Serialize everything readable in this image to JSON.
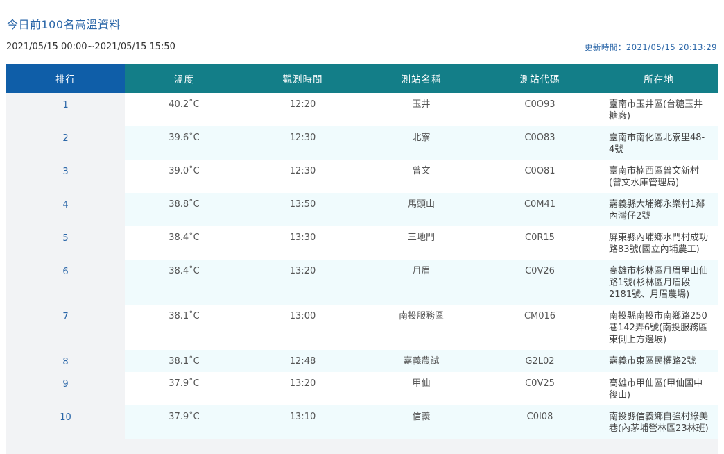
{
  "header": {
    "title": "今日前100名高溫資料",
    "range": "2021/05/15 00:00~2021/05/15 15:50",
    "update": "更新時間：2021/05/15 20:13:29"
  },
  "table": {
    "columns": [
      "排行",
      "溫度",
      "觀測時間",
      "測站名稱",
      "測站代碼",
      "所在地"
    ],
    "rows": [
      {
        "rank": "1",
        "temp": "40.2˚C",
        "time": "12:20",
        "name": "玉井",
        "code": "C0O93",
        "loc": "臺南市玉井區(台糖玉井糖廠)"
      },
      {
        "rank": "2",
        "temp": "39.6˚C",
        "time": "12:30",
        "name": "北寮",
        "code": "C0O83",
        "loc": "臺南市南化區北寮里48-4號"
      },
      {
        "rank": "3",
        "temp": "39.0˚C",
        "time": "12:30",
        "name": "曾文",
        "code": "C0O81",
        "loc": "臺南市楠西區曾文新村(曾文水庫管理局)"
      },
      {
        "rank": "4",
        "temp": "38.8˚C",
        "time": "13:50",
        "name": "馬頭山",
        "code": "C0M41",
        "loc": "嘉義縣大埔鄉永樂村1鄰內灣仔2號"
      },
      {
        "rank": "5",
        "temp": "38.4˚C",
        "time": "13:30",
        "name": "三地門",
        "code": "C0R15",
        "loc": "屏東縣內埔鄉水門村成功路83號(國立內埔農工)"
      },
      {
        "rank": "6",
        "temp": "38.4˚C",
        "time": "13:20",
        "name": "月眉",
        "code": "C0V26",
        "loc": "高雄市杉林區月眉里山仙路1號(杉林區月眉段2181號、月眉農場)"
      },
      {
        "rank": "7",
        "temp": "38.1˚C",
        "time": "13:00",
        "name": "南投服務區",
        "code": "CM016",
        "loc": "南投縣南投市南鄉路250巷142弄6號(南投服務區東側上方邊坡)"
      },
      {
        "rank": "8",
        "temp": "38.1˚C",
        "time": "12:48",
        "name": "嘉義農試",
        "code": "G2L02",
        "loc": "嘉義市東區民權路2號"
      },
      {
        "rank": "9",
        "temp": "37.9˚C",
        "time": "13:20",
        "name": "甲仙",
        "code": "C0V25",
        "loc": "高雄市甲仙區(甲仙國中後山)"
      },
      {
        "rank": "10",
        "temp": "37.9˚C",
        "time": "13:10",
        "name": "信義",
        "code": "C0I08",
        "loc": "南投縣信義鄉自強村綠美巷(內茅埔營林區23林班)"
      }
    ]
  },
  "colors": {
    "header_first": "#0f5ea8",
    "header": "#137e88",
    "temp_hot": "#c8452d",
    "temp_warm": "#e8823a",
    "link": "#2a66a8"
  }
}
